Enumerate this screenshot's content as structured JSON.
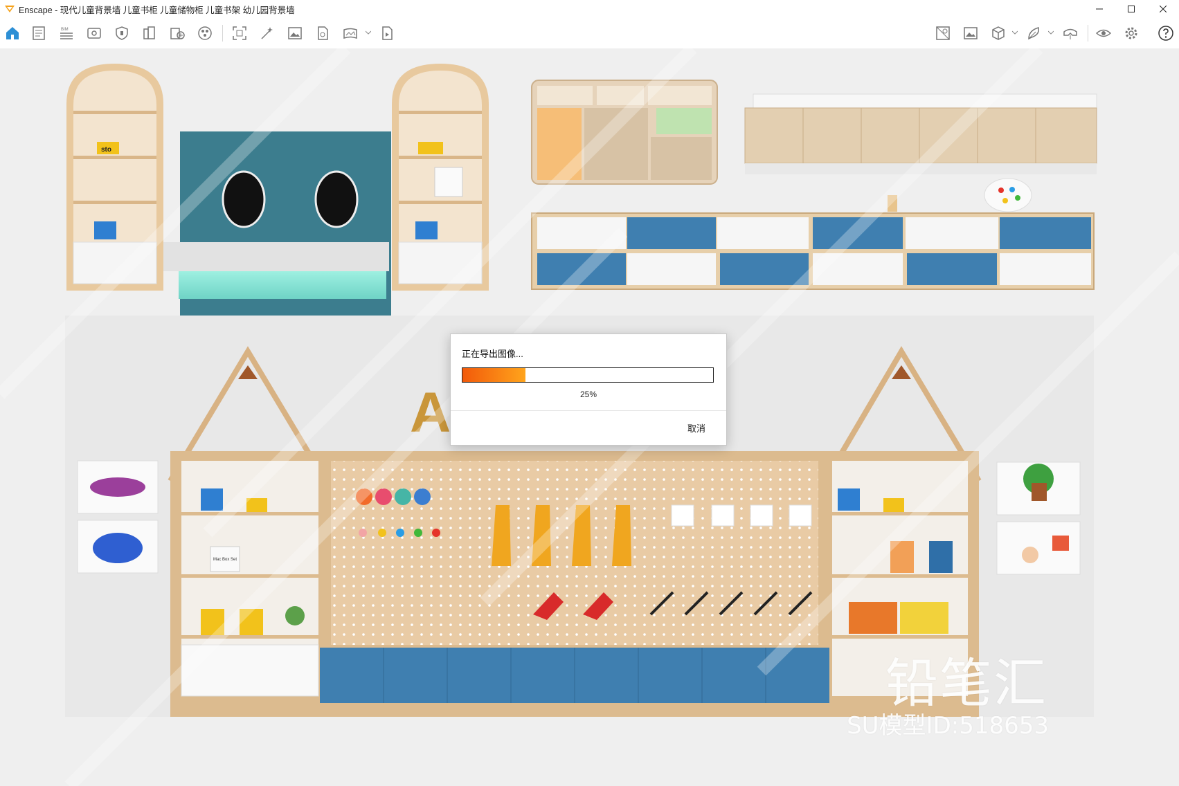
{
  "window": {
    "app_name": "Enscape",
    "title": "Enscape - 现代儿童背景墙 儿童书柜 儿童储物柜 儿童书架 幼儿园背景墙",
    "controls": [
      "minimize",
      "maximize",
      "close"
    ]
  },
  "toolbar": {
    "left_icons": [
      "home-icon",
      "notes-icon",
      "bim-icon",
      "view-icon",
      "shield-icon",
      "assets-icon",
      "asset-library-icon",
      "materials-icon",
      "capture-icon",
      "batch-render-icon",
      "screenshot-icon",
      "exe-icon",
      "panorama-icon",
      "video-icon"
    ],
    "right_icons": [
      "site-context-icon",
      "gallery-icon",
      "cube-icon",
      "material-editor-icon",
      "vr-icon",
      "eye-icon",
      "settings-icon",
      "help-icon"
    ],
    "collapse_icon": "chevron-up-icon",
    "bim_label": "BIM"
  },
  "scene": {
    "sign_text": "ART",
    "brand_label": "sto",
    "book_title": "Mac Box Set"
  },
  "watermark": {
    "logo": "铅笔汇",
    "model_id": "SU模型ID:518653"
  },
  "dialog": {
    "message": "正在导出图像...",
    "progress_value": 25,
    "progress_text": "25%",
    "cancel_label": "取消",
    "colors": {
      "start": "#f25a0a",
      "end": "#ffa41c"
    }
  }
}
